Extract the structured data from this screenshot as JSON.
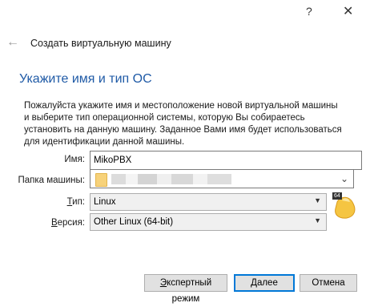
{
  "window": {
    "help_label": "?",
    "close_label": "✕"
  },
  "wizard": {
    "back_icon": "back-arrow-icon",
    "title": "Создать виртуальную машину",
    "heading": "Укажите имя и тип ОС",
    "description": "Пожалуйста укажите имя и местоположение новой виртуальной машины и выберите тип операционной системы, которую Вы собираетесь установить на данную машину. Заданное Вами имя будет использоваться для идентификации данной машины."
  },
  "form": {
    "name_label": "Имя:",
    "name_value": "MikoPBX",
    "folder_label": "Папка машины:",
    "type_label_prefix": "",
    "type_label_underlined": "Т",
    "type_label_suffix": "ип:",
    "type_value": "Linux",
    "version_label_underlined": "В",
    "version_label_suffix": "ерсия:",
    "version_value": "Other Linux (64-bit)",
    "os_badge": "64"
  },
  "buttons": {
    "expert_underlined": "Э",
    "expert_rest": "кспертный режим",
    "next_underlined": "Д",
    "next_rest": "алее",
    "cancel": "Отмена"
  }
}
